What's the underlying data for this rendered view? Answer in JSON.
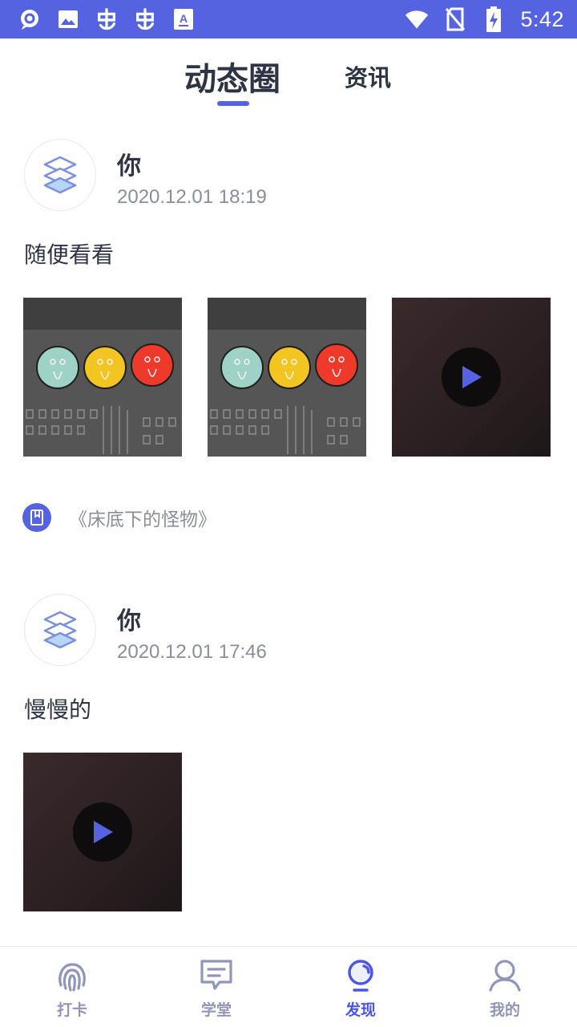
{
  "status_bar": {
    "time": "5:42",
    "left_icons": [
      "chat-bubble-icon",
      "image-icon",
      "bug-icon",
      "bug-icon",
      "font-a-icon"
    ],
    "right_icons": [
      "wifi-icon",
      "no-sim-icon",
      "battery-charging-icon"
    ],
    "background": "#5663e0"
  },
  "tabs": [
    {
      "label": "动态圈",
      "active": true
    },
    {
      "label": "资讯",
      "active": false
    }
  ],
  "posts": [
    {
      "author": "你",
      "time": "2020.12.01 18:19",
      "text": "随便看看",
      "media": [
        "photo-traffic-faces",
        "photo-traffic-faces",
        "video"
      ],
      "book": "《床底下的怪物》"
    },
    {
      "author": "你",
      "time": "2020.12.01 17:46",
      "text": "慢慢的",
      "media": [
        "video"
      ]
    }
  ],
  "bottom_nav": [
    {
      "label": "打卡",
      "icon": "fingerprint-icon",
      "active": false
    },
    {
      "label": "学堂",
      "icon": "message-board-icon",
      "active": false
    },
    {
      "label": "发现",
      "icon": "lightbulb-icon",
      "active": true
    },
    {
      "label": "我的",
      "icon": "person-icon",
      "active": false
    }
  ],
  "colors": {
    "accent": "#5663e0",
    "nav_inactive": "#8f96b8",
    "text_primary": "#2f3444",
    "text_secondary": "#8b8e98"
  }
}
